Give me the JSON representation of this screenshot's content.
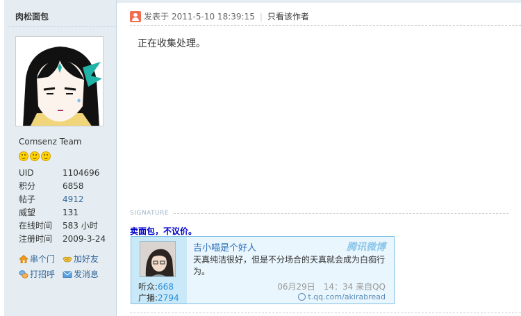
{
  "user": {
    "name": "肉松面包",
    "group": "Comsenz Team",
    "stats": [
      {
        "label": "UID",
        "value": "1104696",
        "link": false
      },
      {
        "label": "积分",
        "value": "6858",
        "link": false
      },
      {
        "label": "帖子",
        "value": "4912",
        "link": true
      },
      {
        "label": "威望",
        "value": "131",
        "link": false
      },
      {
        "label": "在线时间",
        "value": "583 小时",
        "link": false
      },
      {
        "label": "注册时间",
        "value": "2009-3-24",
        "link": false
      }
    ],
    "actions": {
      "visit": "串个门",
      "add_friend": "加好友",
      "greet": "打招呼",
      "message": "发消息"
    }
  },
  "post": {
    "posted_label": "发表于",
    "posted_time": "2011-5-10 18:39:15",
    "author_only": "只看该作者",
    "content": "正在收集处理。"
  },
  "signature": {
    "label": "SIGNATURE",
    "text": "卖面包，不议价。"
  },
  "weibo": {
    "name": "吉小喵是个好人",
    "brand": "腾讯微博",
    "message": "天真纯洁很好，但是不分场合的天真就会成为白痴行为。",
    "listeners_label": "听众:",
    "listeners": "668",
    "broadcasts_label": "广播:",
    "broadcasts": "2794",
    "meta": "06月29日　14：34 来自QQ",
    "url": "t.qq.com/akirabread"
  },
  "colors": {
    "sidebar_bg": "#e5edf2",
    "link": "#336699",
    "signature_text": "#0000cc",
    "card_border": "#7fc1e6"
  }
}
